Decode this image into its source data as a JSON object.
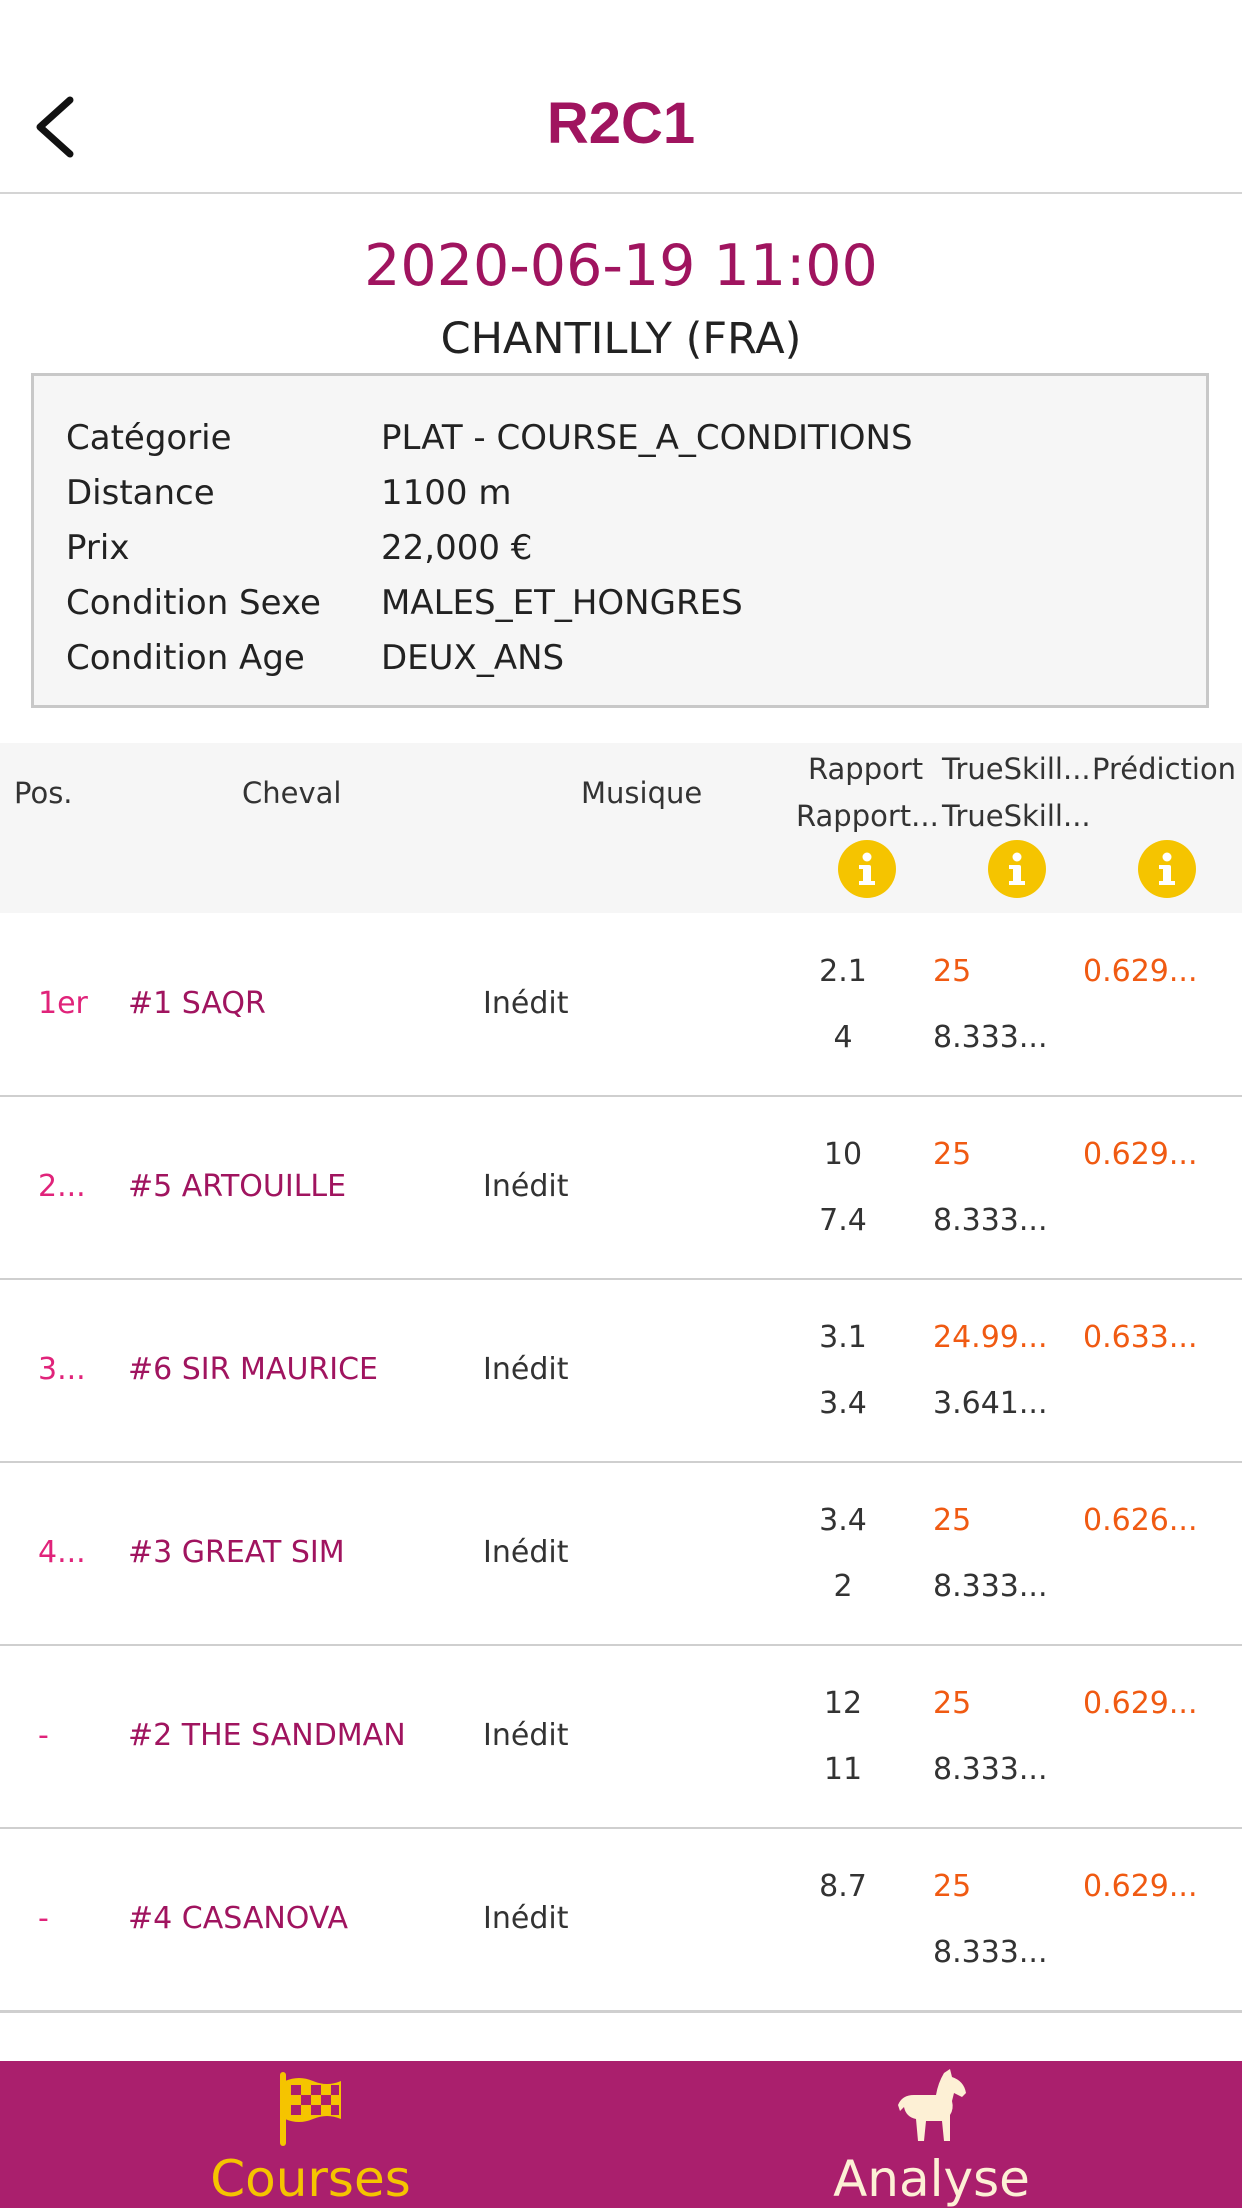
{
  "nav": {
    "title": "R2C1"
  },
  "race": {
    "datetime": "2020-06-19 11:00",
    "venue": "CHANTILLY (FRA)"
  },
  "details": [
    {
      "label": "Catégorie",
      "value": "PLAT - COURSE_A_CONDITIONS"
    },
    {
      "label": "Distance",
      "value": "1100 m"
    },
    {
      "label": "Prix",
      "value": "22,000 €"
    },
    {
      "label": "Condition Sexe",
      "value": "MALES_ET_HONGRES"
    },
    {
      "label": "Condition Age",
      "value": "DEUX_ANS"
    }
  ],
  "table": {
    "headers": {
      "pos": "Pos.",
      "horse": "Cheval",
      "music": "Musique",
      "rapport": "Rapport",
      "rapport2": "Rapport...",
      "trueskill": "TrueSkill...",
      "trueskill2": "TrueSkill...",
      "prediction": "Prédiction"
    },
    "rows": [
      {
        "pos": "1er",
        "horse": "#1 SAQR",
        "music": "Inédit",
        "rapport": "2.1",
        "rapport2": "4",
        "ts_mu": "25",
        "ts_sigma": "8.333...",
        "prediction": "0.629..."
      },
      {
        "pos": "2...",
        "horse": "#5 ARTOUILLE",
        "music": "Inédit",
        "rapport": "10",
        "rapport2": "7.4",
        "ts_mu": "25",
        "ts_sigma": "8.333...",
        "prediction": "0.629..."
      },
      {
        "pos": "3...",
        "horse": "#6 SIR MAURICE",
        "music": "Inédit",
        "rapport": "3.1",
        "rapport2": "3.4",
        "ts_mu": "24.99...",
        "ts_sigma": "3.641...",
        "prediction": "0.633..."
      },
      {
        "pos": "4...",
        "horse": "#3 GREAT SIM",
        "music": "Inédit",
        "rapport": "3.4",
        "rapport2": "2",
        "ts_mu": "25",
        "ts_sigma": "8.333...",
        "prediction": "0.626..."
      },
      {
        "pos": "-",
        "horse": "#2 THE SANDMAN",
        "music": "Inédit",
        "rapport": "12",
        "rapport2": "11",
        "ts_mu": "25",
        "ts_sigma": "8.333...",
        "prediction": "0.629..."
      },
      {
        "pos": "-",
        "horse": "#4 CASANOVA",
        "music": "Inédit",
        "rapport": "8.7",
        "rapport2": "",
        "ts_mu": "25",
        "ts_sigma": "8.333...",
        "prediction": "0.629..."
      }
    ]
  },
  "tabbar": {
    "courses": {
      "label": "Courses",
      "icon": "checkered-flag-icon",
      "color": "#f5c400"
    },
    "analyse": {
      "label": "Analyse",
      "icon": "horse-icon",
      "color": "#fdf0d5"
    }
  },
  "colors": {
    "brand": "#a0145f",
    "tabbar_bg": "#aa1f6d",
    "accent_orange": "#f05a12",
    "position_pink": "#e0237a",
    "info_yellow": "#f5c400"
  }
}
